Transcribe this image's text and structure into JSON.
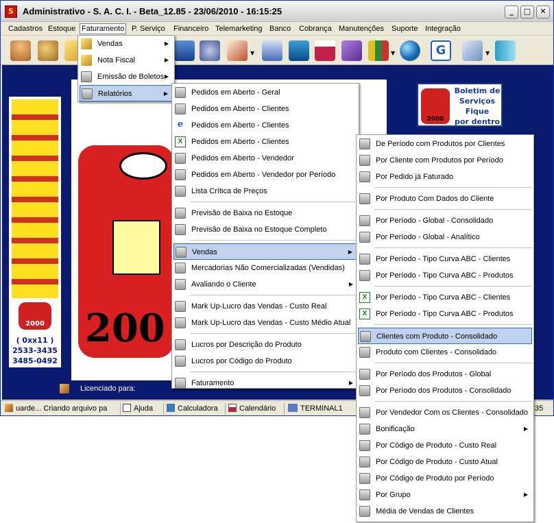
{
  "window": {
    "title": "Administrativo - S. A. C. I. - Beta_12.85 - 23/06/2010 - 16:15:25",
    "app_icon": "app-logo-icon",
    "min": "_",
    "max": "□",
    "close": "✕"
  },
  "menubar": [
    "Cadastros",
    "Estoque",
    "Faturamento",
    "P. Serviço",
    "Financeiro",
    "Telemarketing",
    "Banco",
    "Cobrança",
    "Manutenções",
    "Suporte",
    "Integração"
  ],
  "faturamento_menu": [
    "Vendas",
    "Nota Fiscal",
    "Emissão de Boletos",
    "Relatórios"
  ],
  "relatorios_menu": [
    "Pedidos em Aberto - Geral",
    "Pedidos em Aberto - Clientes",
    "Pedidos em Aberto - Clientes",
    "Pedidos em Aberto - Clientes",
    "Pedidos em Aberto - Vendedor",
    "Pedidos em Aberto - Vendedor por Período",
    "Lista Crítica de Preços",
    "Previsão de Baixa no Estoque",
    "Previsão de Baixa no Estoque Completo",
    "Vendas",
    "Mercadorias Não Comercializadas (Vendidas)",
    "Avaliando o Cliente",
    "Mark Up-Lucro das Vendas - Custo Real",
    "Mark Up-Lucro das Vendas - Custo Médio Atual",
    "Lucros por Descrição do Produto",
    "Lucros por Código do Produto",
    "Faturamento"
  ],
  "vendas_menu": [
    "De Período com Produtos por Clientes",
    "Por Cliente com Produtos por Período",
    "Por Pedido já Faturado",
    "Por Produto Com Dados do Cliente",
    "Por Período - Global - Consolidado",
    "Por Período - Global - Analítico",
    "Por Período - Tipo Curva ABC - Clientes",
    "Por Período - Tipo Curva ABC - Produtos",
    "Por Período - Tipo Curva ABC - Clientes",
    "Por Período - Tipo Curva ABC - Produtos",
    "Clientes com Produto - Consolidado",
    "Produto com Clientes - Consolidado",
    "Por Período dos Produtos - Global",
    "Por Período dos Produtos - Consolidado",
    "Por Vendedor Com os Clientes - Consolidado",
    "Bonificação",
    "Por Código de Produto - Custo Real",
    "Por Código de Produto - Custo Atual",
    "Por Código de Produto por Período",
    "Por Grupo",
    "Média de Vendas de Clientes"
  ],
  "left_banner": {
    "phone_prefix": "( 0xx11 )",
    "phone1": "2533-3435",
    "phone2": "3485-0492",
    "logo_text": "2000"
  },
  "center_banner": {
    "logo_text": "200"
  },
  "boletim": {
    "line1": "Boletim de",
    "line2": "Serviços",
    "line3": "Fique",
    "line4": "por dentro",
    "logo_text": "2000"
  },
  "licensed_label": "Licenciado para:",
  "status": {
    "msg": "uarde... Criando arquivo pa",
    "ajuda": "Ajuda",
    "calc": "Calculadora",
    "cal": "Calendário",
    "terminal": "TERMINAL1",
    "clock": ":35"
  },
  "colors": {
    "menu_highlight": "#c1d2ee",
    "highlight_border": "#316ac5",
    "desktop": "#0a1a6e"
  }
}
